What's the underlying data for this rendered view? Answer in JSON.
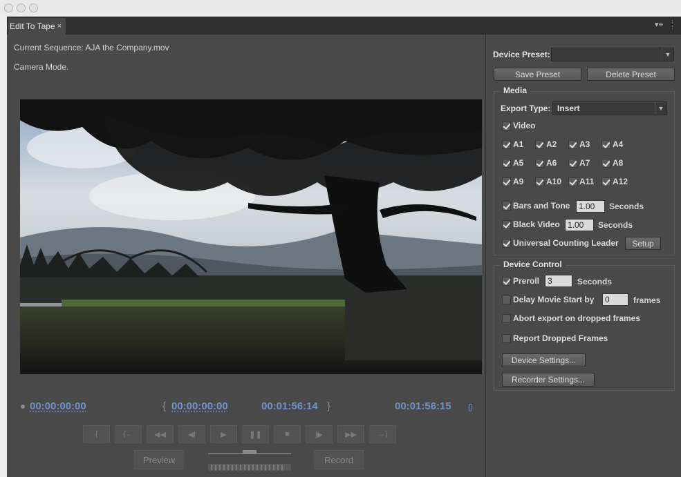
{
  "panel": {
    "tab_title": "Edit To Tape",
    "tab_close": "×",
    "menu_icon": "▾≡",
    "current_sequence": "Current Sequence: AJA the Company.mov",
    "mode": "Camera Mode."
  },
  "timecodes": {
    "current": "00:00:00:00",
    "in_brace": "{",
    "in": "00:00:00:00",
    "out": "00:01:56:14",
    "out_brace": "}",
    "duration": "00:01:56:15",
    "duration_icon": "{}"
  },
  "transport": [
    {
      "icon": "step-back-icon",
      "glyph": "{"
    },
    {
      "icon": "go-to-in-icon",
      "glyph": "{←"
    },
    {
      "icon": "rewind-icon",
      "glyph": "◀◀"
    },
    {
      "icon": "step-frame-back-icon",
      "glyph": "◀|"
    },
    {
      "icon": "play-icon",
      "glyph": "▶"
    },
    {
      "icon": "pause-icon",
      "glyph": "❚❚"
    },
    {
      "icon": "stop-icon",
      "glyph": "■"
    },
    {
      "icon": "step-frame-forward-icon",
      "glyph": "|▶"
    },
    {
      "icon": "fast-forward-icon",
      "glyph": "▶▶"
    },
    {
      "icon": "go-to-out-icon",
      "glyph": "→}"
    }
  ],
  "buttons": {
    "preview": "Preview",
    "record": "Record"
  },
  "preset": {
    "label": "Device Preset:",
    "value": "",
    "save": "Save Preset",
    "delete": "Delete Preset"
  },
  "media": {
    "legend": "Media",
    "export_type_label": "Export Type:",
    "export_type_value": "Insert",
    "video": "Video",
    "audio_rows": [
      [
        "A1",
        "A2",
        "A3",
        "A4"
      ],
      [
        "A5",
        "A6",
        "A7",
        "A8"
      ],
      [
        "A9",
        "A10",
        "A11",
        "A12"
      ]
    ],
    "bars_and_tone": "Bars and Tone",
    "bars_value": "1.00",
    "black_video": "Black Video",
    "black_value": "1.00",
    "seconds": "Seconds",
    "ucl": "Universal Counting Leader",
    "setup": "Setup"
  },
  "device_control": {
    "legend": "Device Control",
    "preroll": "Preroll",
    "preroll_value": "3",
    "seconds": "Seconds",
    "delay": "Delay Movie Start by",
    "delay_value": "0",
    "frames": "frames",
    "abort": "Abort export on dropped frames",
    "report": "Report Dropped Frames",
    "device_settings": "Device Settings...",
    "recorder_settings": "Recorder Settings..."
  }
}
